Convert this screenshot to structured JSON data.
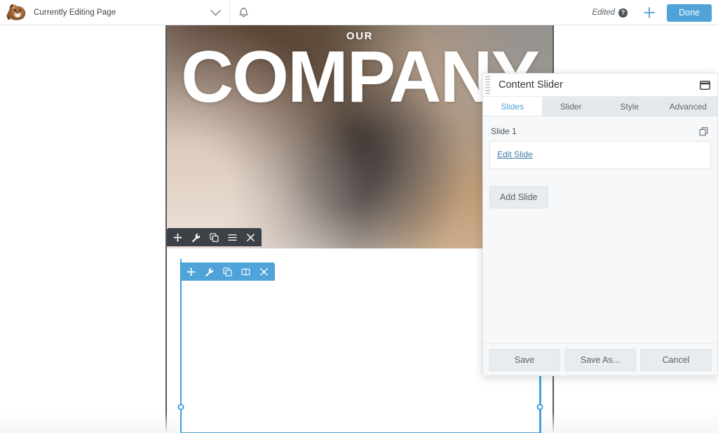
{
  "topbar": {
    "logo_icon": "beaver-logo-icon",
    "editing_label": "Currently Editing Page",
    "chevron_icon": "chevron-down-icon",
    "bell_icon": "bell-icon",
    "edited_text": "Edited",
    "help_icon": "?",
    "plus_icon": "plus-icon",
    "done_label": "Done",
    "accent_color": "#4fa3d8"
  },
  "canvas": {
    "hero": {
      "kicker": "OUR",
      "title": "COMPANY"
    },
    "row_toolbar": {
      "icons": [
        "move-icon",
        "wrench-icon",
        "duplicate-icon",
        "menu-icon",
        "close-icon"
      ],
      "background_color": "#3b4146"
    },
    "module_toolbar": {
      "icons": [
        "move-icon",
        "wrench-icon",
        "duplicate-icon",
        "columns-icon",
        "close-icon"
      ],
      "background_color": "#4fa3d8"
    },
    "resize_handles": [
      "left-resize-handle",
      "right-resize-handle"
    ]
  },
  "panel": {
    "title": "Content Slider",
    "grip_icon": "drag-grip-icon",
    "window_icon": "window-restore-icon",
    "tabs": [
      {
        "label": "Slides",
        "active": true
      },
      {
        "label": "Slider",
        "active": false
      },
      {
        "label": "Style",
        "active": false
      },
      {
        "label": "Advanced",
        "active": false
      }
    ],
    "slide": {
      "label": "Slide 1",
      "duplicate_icon": "duplicate-icon",
      "edit_link": "Edit Slide"
    },
    "add_slide_label": "Add Slide",
    "footer": {
      "save_label": "Save",
      "save_as_label": "Save As...",
      "cancel_label": "Cancel"
    }
  }
}
